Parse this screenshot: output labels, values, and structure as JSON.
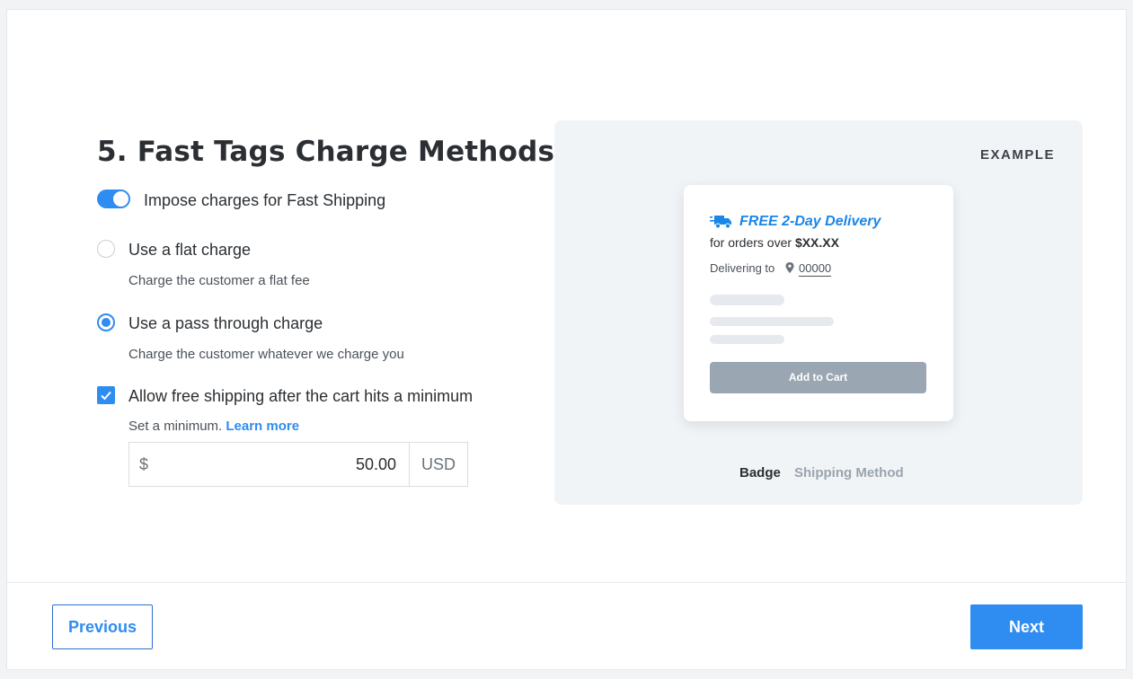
{
  "step": {
    "title": "5. Fast Tags Charge Methods"
  },
  "toggle": {
    "label": "Impose charges for Fast Shipping",
    "on": true
  },
  "options": [
    {
      "label": "Use a flat charge",
      "description": "Charge the customer a flat fee",
      "selected": false
    },
    {
      "label": "Use a pass through charge",
      "description": "Charge the customer whatever we charge you",
      "selected": true
    }
  ],
  "free_shipping": {
    "label": "Allow free shipping after the cart hits a minimum",
    "checked": true,
    "help_text": "Set a minimum.",
    "learn_more": "Learn more",
    "currency_symbol": "$",
    "amount": "50.00",
    "currency": "USD"
  },
  "example": {
    "label": "EXAMPLE",
    "badge_title": "FREE 2-Day Delivery",
    "badge_sub_prefix": "for orders over",
    "badge_sub_amount": "$XX.XX",
    "delivering_to": "Delivering to",
    "zip": "00000",
    "add_to_cart": "Add to Cart",
    "tabs": [
      "Badge",
      "Shipping Method"
    ],
    "active_tab": "Badge",
    "icons": [
      "truck-icon",
      "map-pin-icon"
    ]
  },
  "footer": {
    "previous": "Previous",
    "next": "Next"
  },
  "colors": {
    "accent": "#2f8cf0",
    "badge_blue": "#1a86e8",
    "button_disabled": "#9aa6b2"
  }
}
